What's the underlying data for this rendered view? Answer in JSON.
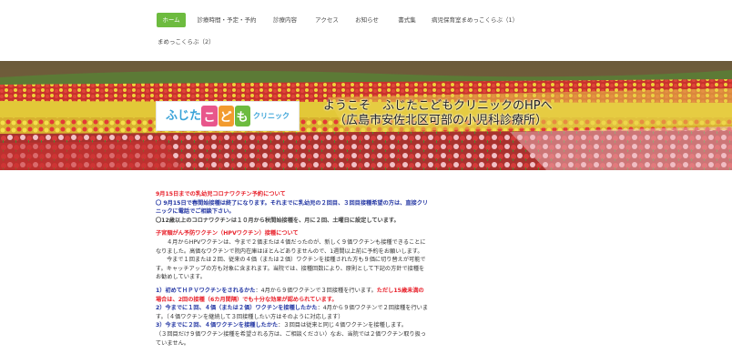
{
  "nav": {
    "items": [
      {
        "label": "ホーム",
        "active": true
      },
      {
        "label": "診療時間・予定・予約"
      },
      {
        "label": "診療内容"
      },
      {
        "label": "アクセス"
      },
      {
        "label": "お知らせ"
      },
      {
        "label": "書式集"
      },
      {
        "label": "病児保育室まめっこくらぶ（1）"
      },
      {
        "label": "まめっこくらぶ（2）"
      }
    ]
  },
  "hero": {
    "logo": {
      "part1": "ふじた",
      "part2": "こ",
      "part3": "ど",
      "part4": "も",
      "part5": "クリニック"
    },
    "title_line1": "ようこそ　ふじたこどもクリニックのHPへ",
    "title_line2": "（広島市安佐北区可部の小児科診療所）",
    "colors": {
      "logo_green": "#6dbb3f",
      "logo_pink": "#e8568b",
      "logo_blue": "#3aa3d8",
      "logo_orange": "#f29b2e"
    }
  },
  "content": {
    "covid_heading": "9月15日までの乳幼児コロナワクチン予約について",
    "covid_line1": "〇 9月15日で春間始接種は終了になります。それまでに乳幼児の２回目、３回目接種希望の方は、直接クリニックに電話でご相談下さい。",
    "covid_line2": "〇12歳以上のコロナワクチンは１０月から秋間始接種を、月に２回、土曜日に設定しています。",
    "hpv_heading": "子宮頸がん予防ワクチン（HPVワクチン）接種について",
    "hpv_p1": "４月からHPVワクチンは、今まで２価または４価だったのが、新しく９価ワクチンも接種できることになりました。高価なワクチンで院内在庫はほとんどありませんので、1週間以上前に予約をお願いします。",
    "hpv_p2": "今まで１回または２回、従来の４価（または２価）ワクチンを接種された方も９価に切り替えが可能です。キャッチアップの方も対象に含まれます。当院では、接種回数により、原則として下記の方針で接種をお勧めしています。",
    "item1_lead": "1）初めてＨＰＶワクチンをされるかた",
    "item1_text": "：4月から９価ワクチンで３回接種を行います。",
    "item1_red": "ただし15歳未満の場合は、2回の接種（6カ月間隔）でも十分な効果が認められています。",
    "item2_lead": "2）今までに１回、４価（または２価）ワクチンを接種したかた",
    "item2_text": "：4月から９価ワクチンで２回接種を行います。（４価ワクチンを継続して３回接種したい方はそのように対応します）",
    "item3_lead": "3）今までに２回、４価ワクチンを接種したかた",
    "item3_text": "：３回目は従来と同じ４価ワクチンを接種します。",
    "item3_more": "（３回目だけ９価ワクチン接種を希望される方は、ご相談ください）なお、当院では２価ワクチン取り扱っていません。"
  }
}
